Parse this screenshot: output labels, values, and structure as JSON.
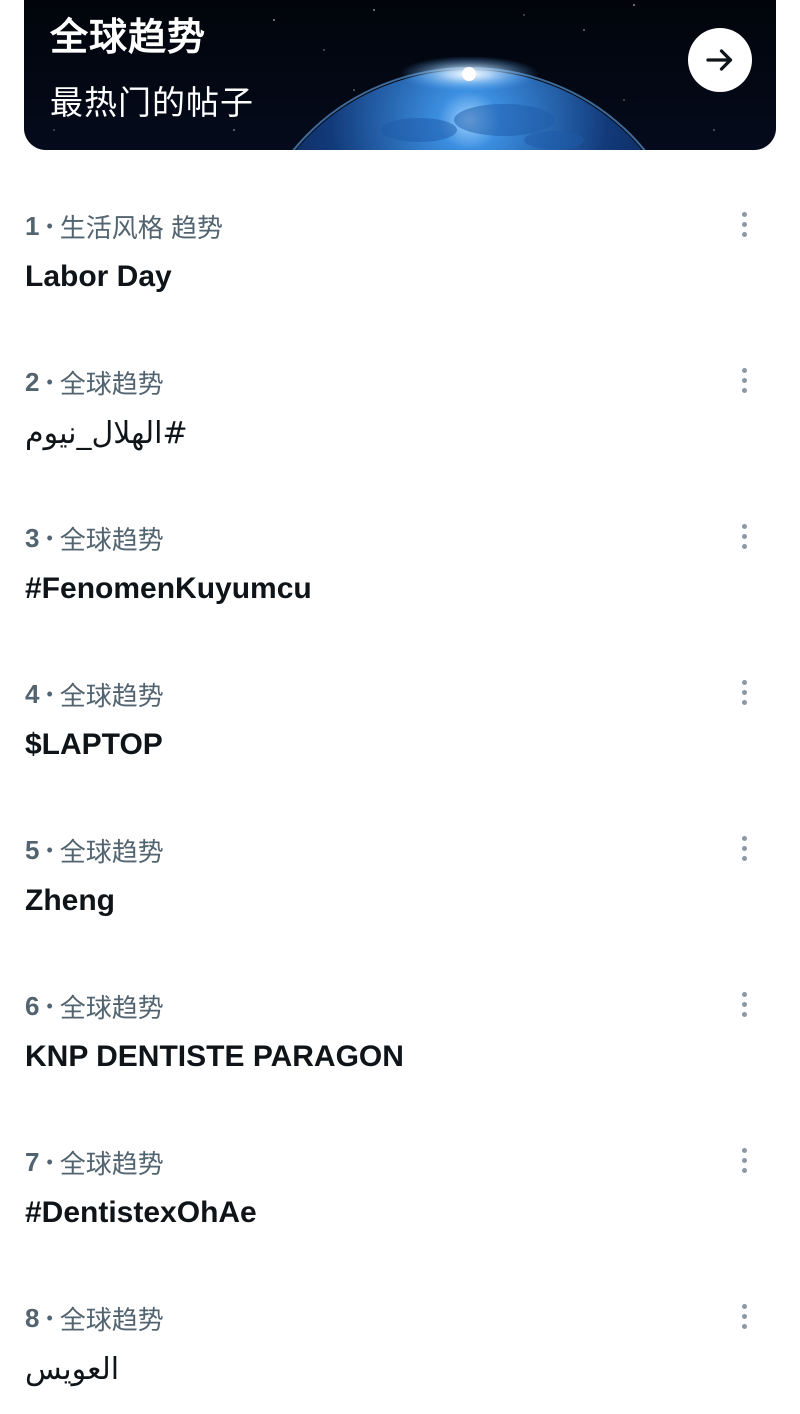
{
  "banner": {
    "title": "全球趋势",
    "subtitle": "最热门的帖子",
    "arrow_icon": "arrow-right-icon",
    "colors": {
      "background": "#02040b",
      "earth_glow": "#4aa8ff",
      "arrow_button": "#ffffff"
    }
  },
  "trends": [
    {
      "rank": "1",
      "category": "生活风格 趋势",
      "name": "Labor Day",
      "rtl": false
    },
    {
      "rank": "2",
      "category": "全球趋势",
      "name": "#الهلال_نيوم",
      "rtl": true
    },
    {
      "rank": "3",
      "category": "全球趋势",
      "name": "#FenomenKuyumcu",
      "rtl": false
    },
    {
      "rank": "4",
      "category": "全球趋势",
      "name": "$LAPTOP",
      "rtl": false
    },
    {
      "rank": "5",
      "category": "全球趋势",
      "name": "Zheng",
      "rtl": false
    },
    {
      "rank": "6",
      "category": "全球趋势",
      "name": "KNP DENTISTE PARAGON",
      "rtl": false
    },
    {
      "rank": "7",
      "category": "全球趋势",
      "name": "#DentistexOhAe",
      "rtl": false
    },
    {
      "rank": "8",
      "category": "全球趋势",
      "name": "العويس",
      "rtl": true
    }
  ],
  "icons": {
    "more": "more-vertical-icon"
  },
  "colors": {
    "primary_text": "#0f1419",
    "secondary_text": "#536471",
    "more_icon": "#8b98a5"
  }
}
